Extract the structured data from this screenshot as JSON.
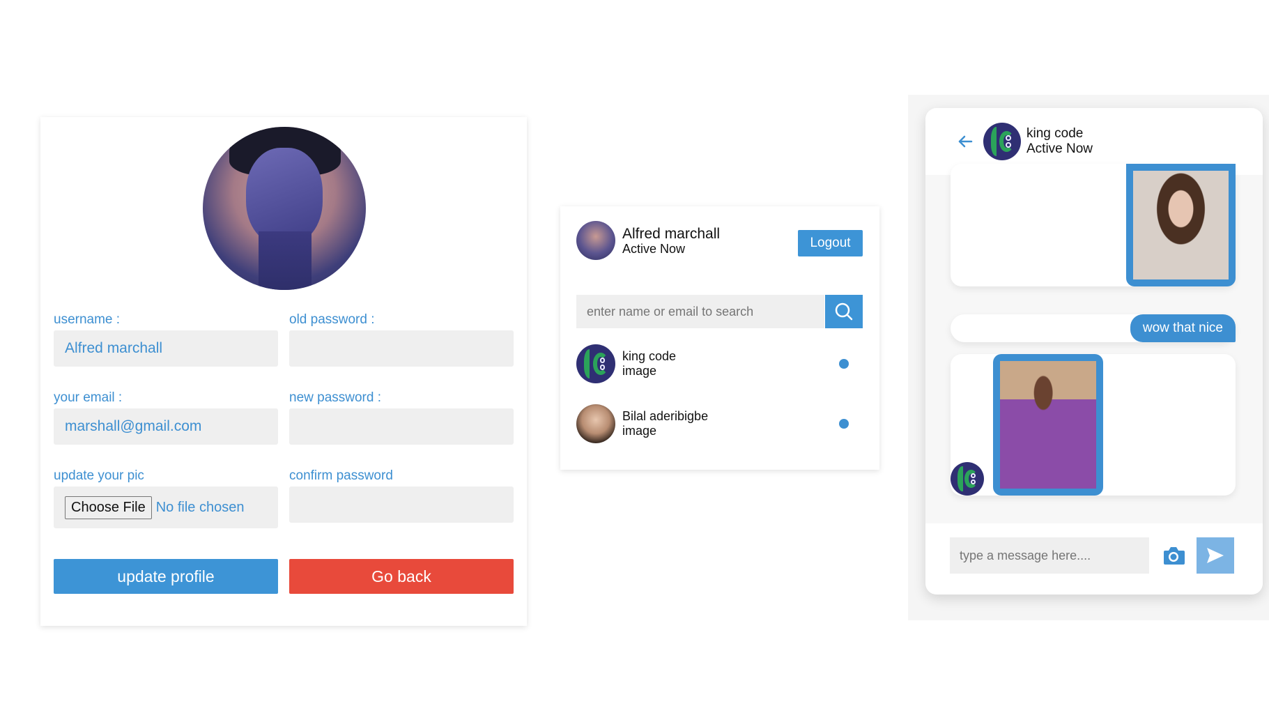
{
  "profile": {
    "username_label": "username :",
    "username_value": "Alfred marchall",
    "old_password_label": "old password :",
    "email_label": "your email :",
    "email_value": "marshall@gmail.com",
    "new_password_label": "new password :",
    "update_pic_label": "update your pic",
    "choose_file_label": "Choose File",
    "no_file_text": "No file chosen",
    "confirm_password_label": "confirm password",
    "update_button": "update profile",
    "back_button": "Go back"
  },
  "users": {
    "current_user_name": "Alfred marchall",
    "current_user_status": "Active Now",
    "logout_label": "Logout",
    "search_placeholder": "enter name or email to search",
    "list": [
      {
        "name": "king code",
        "last_message": "image",
        "online": true
      },
      {
        "name": "Bilal aderibigbe",
        "last_message": "image",
        "online": true
      }
    ]
  },
  "chat": {
    "contact_name": "king code",
    "contact_status": "Active Now",
    "messages": [
      {
        "type": "image",
        "direction": "outgoing",
        "subject": "woman portrait"
      },
      {
        "type": "text",
        "direction": "outgoing",
        "text": "wow that nice"
      },
      {
        "type": "image",
        "direction": "incoming",
        "subject": "boy portrait"
      }
    ],
    "input_placeholder": "type a message here....",
    "icons": {
      "back": "arrow-left-icon",
      "camera": "camera-icon",
      "send": "send-icon"
    }
  },
  "colors": {
    "accent": "#3d94d6",
    "danger": "#e84a3b",
    "field_bg": "#efefef"
  }
}
